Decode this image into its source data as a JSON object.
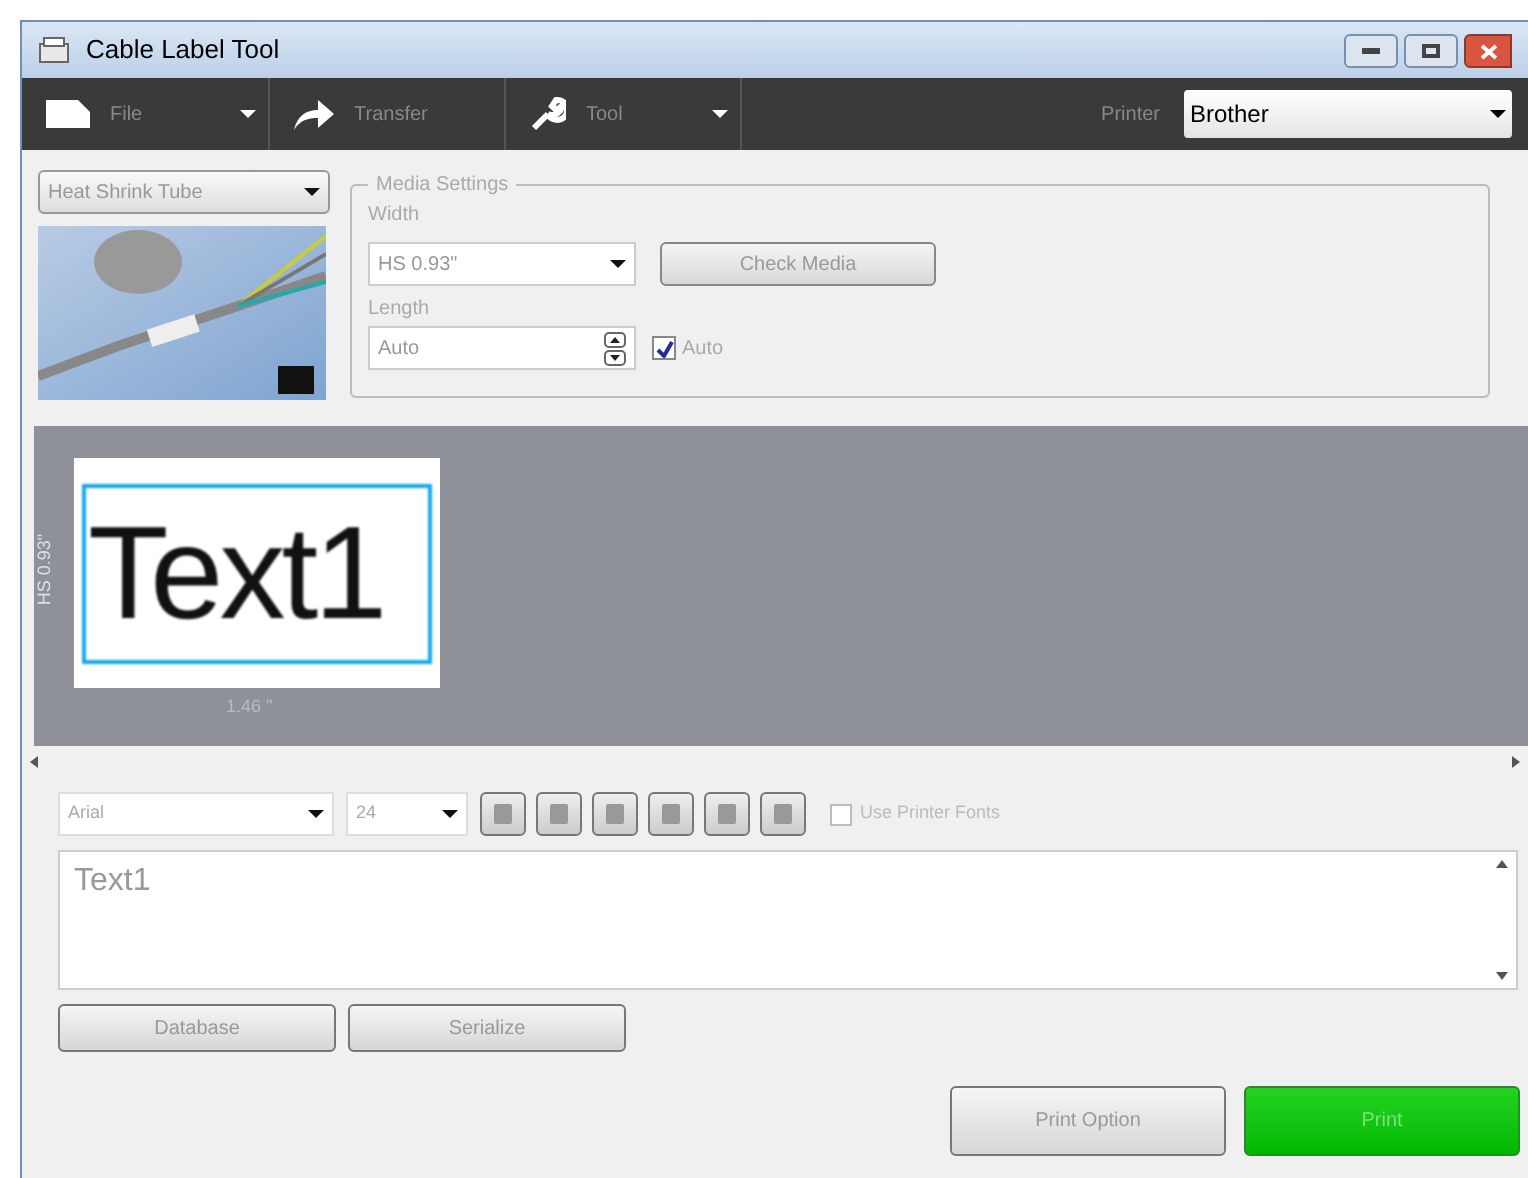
{
  "window": {
    "title": "Cable Label Tool"
  },
  "toolbar": {
    "items": [
      {
        "label": "File",
        "dropdown": true
      },
      {
        "label": "Transfer",
        "dropdown": false
      },
      {
        "label": "Tool",
        "dropdown": true
      }
    ],
    "printer_label": "Printer",
    "printer": "Brother"
  },
  "media_type": {
    "value": "Heat Shrink Tube"
  },
  "media_settings": {
    "title": "Media Settings",
    "width_label": "Width",
    "width": "HS 0.93\"",
    "check_media": "Check Media",
    "length_label": "Length",
    "length": "Auto",
    "auto": {
      "label": "Auto",
      "checked": true
    }
  },
  "preview": {
    "text": "Text1",
    "height_label": "HS 0.93\"",
    "width_label": "1.46 \""
  },
  "font_bar": {
    "font": "Arial",
    "size": "24",
    "use_printer_fonts": {
      "label": "Use Printer Fonts",
      "checked": false
    }
  },
  "text_input": {
    "value": "Text1"
  },
  "buttons": [
    {
      "label": "Database",
      "kind": "plain"
    },
    {
      "label": "Serialize",
      "kind": "plain"
    }
  ],
  "print_buttons": [
    {
      "label": "Print Option",
      "kind": "plain"
    },
    {
      "label": "Print",
      "kind": "primary"
    }
  ]
}
